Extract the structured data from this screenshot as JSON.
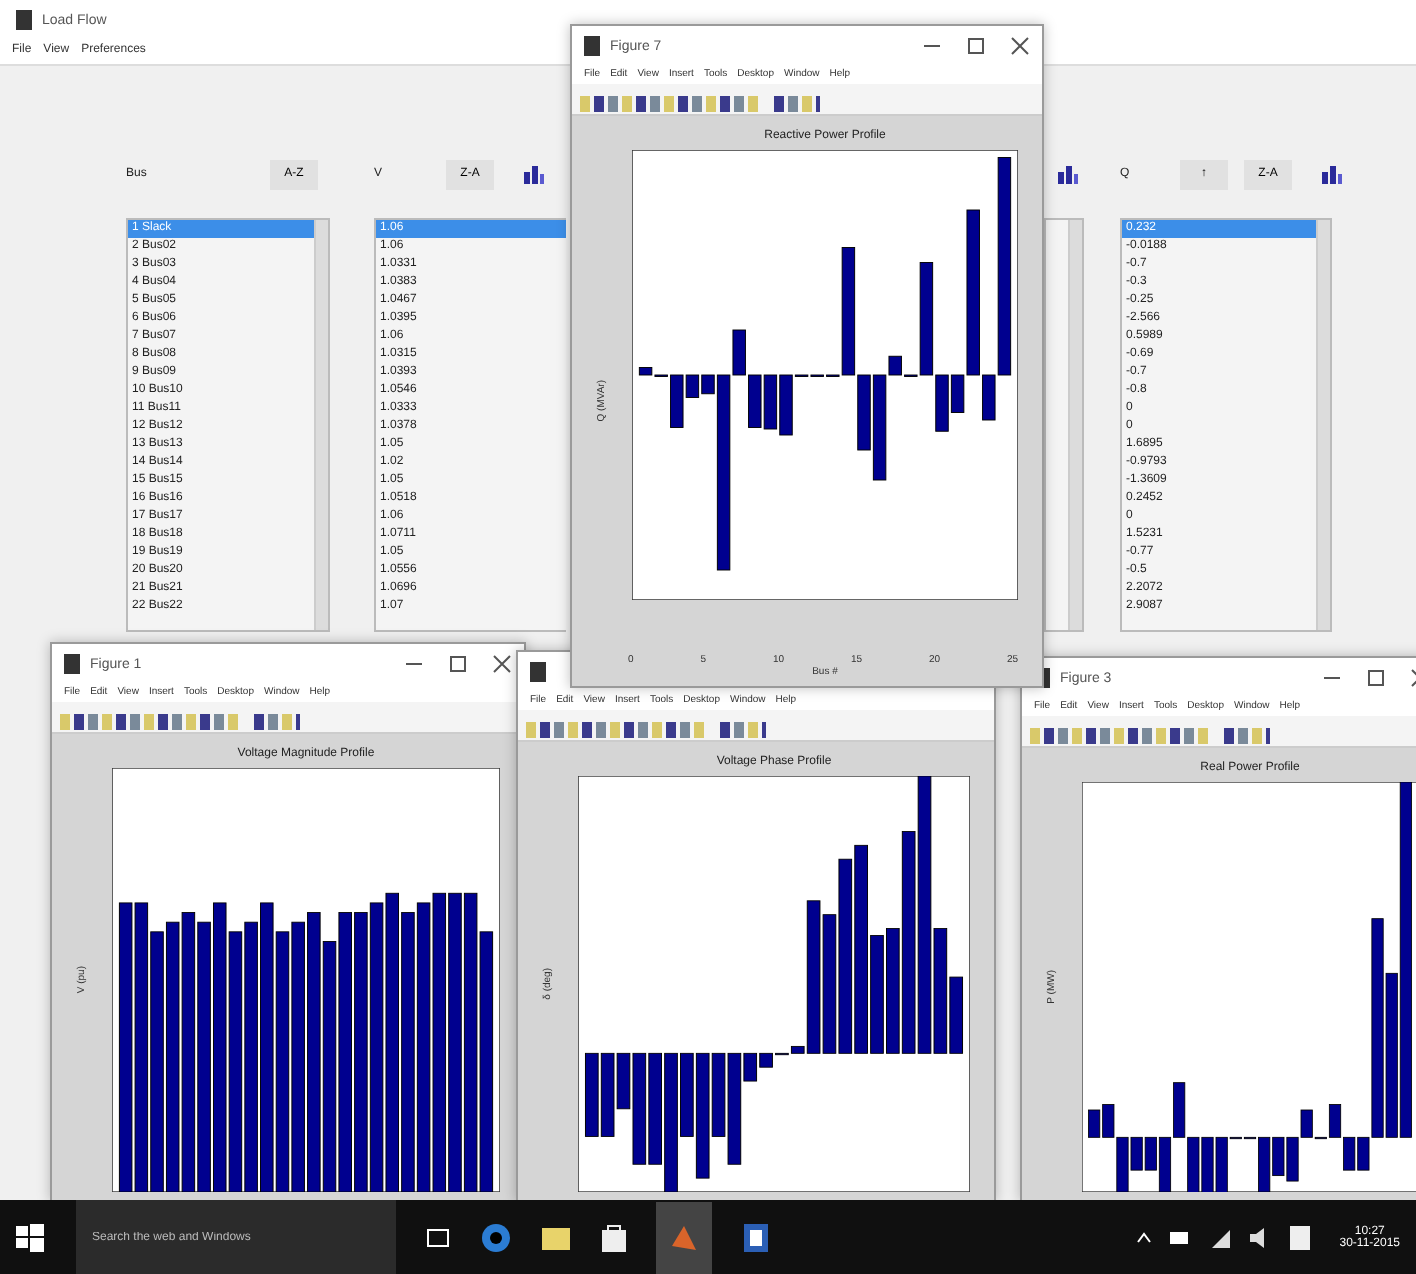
{
  "main_window": {
    "title": "Load Flow",
    "menu": [
      "File",
      "View",
      "Preferences"
    ],
    "panels": [
      {
        "label": "Bus",
        "buttons": [
          {
            "kind": "text",
            "label": "A-Z"
          }
        ],
        "items": [
          {
            "text": "1 Slack",
            "selected": true
          },
          {
            "text": "2 Bus02",
            "selected": false
          },
          {
            "text": "3 Bus03",
            "selected": false
          },
          {
            "text": "4 Bus04",
            "selected": false
          },
          {
            "text": "5 Bus05",
            "selected": false
          },
          {
            "text": "6 Bus06",
            "selected": false
          },
          {
            "text": "7 Bus07",
            "selected": false
          },
          {
            "text": "8 Bus08",
            "selected": false
          },
          {
            "text": "9 Bus09",
            "selected": false
          },
          {
            "text": "10 Bus10",
            "selected": false
          },
          {
            "text": "11 Bus11",
            "selected": false
          },
          {
            "text": "12 Bus12",
            "selected": false
          },
          {
            "text": "13 Bus13",
            "selected": false
          },
          {
            "text": "14 Bus14",
            "selected": false
          },
          {
            "text": "15 Bus15",
            "selected": false
          },
          {
            "text": "16 Bus16",
            "selected": false
          },
          {
            "text": "17 Bus17",
            "selected": false
          },
          {
            "text": "18 Bus18",
            "selected": false
          },
          {
            "text": "19 Bus19",
            "selected": false
          },
          {
            "text": "20 Bus20",
            "selected": false
          },
          {
            "text": "21 Bus21",
            "selected": false
          },
          {
            "text": "22 Bus22",
            "selected": false
          }
        ]
      },
      {
        "label": "V",
        "buttons": [
          {
            "kind": "text",
            "label": "Z-A"
          },
          {
            "kind": "icon"
          }
        ],
        "items": [
          {
            "text": "1.06",
            "selected": true
          },
          {
            "text": "1.06",
            "selected": false
          },
          {
            "text": "1.0331",
            "selected": false
          },
          {
            "text": "1.0383",
            "selected": false
          },
          {
            "text": "1.0467",
            "selected": false
          },
          {
            "text": "1.0395",
            "selected": false
          },
          {
            "text": "1.06",
            "selected": false
          },
          {
            "text": "1.0315",
            "selected": false
          },
          {
            "text": "1.0393",
            "selected": false
          },
          {
            "text": "1.0546",
            "selected": false
          },
          {
            "text": "1.0333",
            "selected": false
          },
          {
            "text": "1.0378",
            "selected": false
          },
          {
            "text": "1.05",
            "selected": false
          },
          {
            "text": "1.02",
            "selected": false
          },
          {
            "text": "1.05",
            "selected": false
          },
          {
            "text": "1.0518",
            "selected": false
          },
          {
            "text": "1.06",
            "selected": false
          },
          {
            "text": "1.0711",
            "selected": false
          },
          {
            "text": "1.05",
            "selected": false
          },
          {
            "text": "1.0556",
            "selected": false
          },
          {
            "text": "1.0696",
            "selected": false
          },
          {
            "text": "1.07",
            "selected": false
          }
        ]
      },
      {
        "buttons": [
          {
            "kind": "icon"
          }
        ]
      },
      {
        "label": "Q",
        "buttons": [
          {
            "kind": "text",
            "label": "↑"
          },
          {
            "kind": "text",
            "label": "Z-A"
          },
          {
            "kind": "icon"
          }
        ],
        "items": [
          {
            "text": "0.232",
            "selected": true
          },
          {
            "text": "-0.0188",
            "selected": false
          },
          {
            "text": "-0.7",
            "selected": false
          },
          {
            "text": "-0.3",
            "selected": false
          },
          {
            "text": "-0.25",
            "selected": false
          },
          {
            "text": "-2.566",
            "selected": false
          },
          {
            "text": "0.5989",
            "selected": false
          },
          {
            "text": "-0.69",
            "selected": false
          },
          {
            "text": "-0.7",
            "selected": false
          },
          {
            "text": "-0.8",
            "selected": false
          },
          {
            "text": "0",
            "selected": false
          },
          {
            "text": "0",
            "selected": false
          },
          {
            "text": "1.6895",
            "selected": false
          },
          {
            "text": "-0.9793",
            "selected": false
          },
          {
            "text": "-1.3609",
            "selected": false
          },
          {
            "text": "0.2452",
            "selected": false
          },
          {
            "text": "0",
            "selected": false
          },
          {
            "text": "1.5231",
            "selected": false
          },
          {
            "text": "-0.77",
            "selected": false
          },
          {
            "text": "-0.5",
            "selected": false
          },
          {
            "text": "2.2072",
            "selected": false
          },
          {
            "text": "2.9087",
            "selected": false
          }
        ]
      }
    ]
  },
  "figures": [
    {
      "title": "Figure 7",
      "menu": [
        "File",
        "Edit",
        "View",
        "Insert",
        "Tools",
        "Desktop",
        "Window",
        "Help"
      ],
      "plot_title": "Reactive Power Profile",
      "ylabel": "Q (MVAr)",
      "xlabel": "Bus #",
      "xtick_labels": [
        "0",
        "5",
        "10",
        "15",
        "20",
        "25"
      ]
    },
    {
      "title": "Figure 1",
      "menu": [
        "File",
        "Edit",
        "View",
        "Insert",
        "Tools",
        "Desktop",
        "Window",
        "Help"
      ],
      "plot_title": "Voltage Magnitude Profile",
      "ylabel": "V (pu)"
    },
    {
      "menu": [
        "File",
        "Edit",
        "View",
        "Insert",
        "Tools",
        "Desktop",
        "Window",
        "Help"
      ],
      "plot_title": "Voltage Phase Profile",
      "ylabel": "δ (deg)"
    },
    {
      "title": "Figure 3",
      "menu": [
        "File",
        "Edit",
        "View",
        "Insert",
        "Tools",
        "Desktop",
        "Window",
        "Help"
      ],
      "plot_title": "Real Power Profile",
      "ylabel": "P (MW)"
    }
  ],
  "taskbar": {
    "search_placeholder": "Search the web and Windows",
    "time": "10:27",
    "date": "30-11-2015"
  }
}
